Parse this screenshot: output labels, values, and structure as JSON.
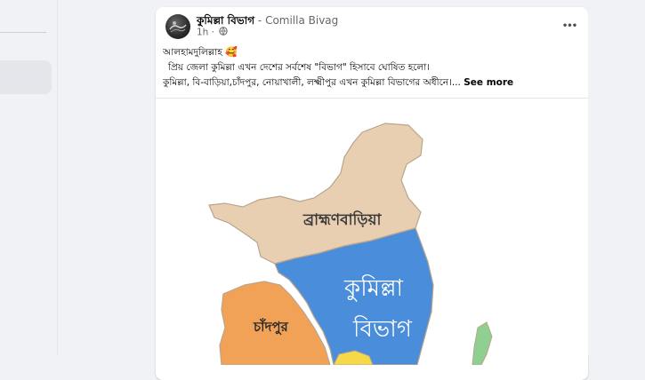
{
  "post": {
    "page_name": "কুমিল্লা বিভাগ",
    "separator": " - ",
    "page_name_en": "Comilla Bivag",
    "time": "1h",
    "meta_dot": " · ",
    "privacy_icon": "globe-icon",
    "more_icon": "more-horizontal-icon",
    "more_label": "•••",
    "text_line1": "আলহামদুলিল্লাহ",
    "emoji": "🥰",
    "text_line2": "প্রিয় জেলা কুমিল্লা এখন দেশের সর্বশেষ \"বিভাগ\" হিসাবে ঘোষিত হলো।",
    "text_line3": "কুমিল্লা, বি-বাড়িয়া,চাঁদপুর, নোয়াখালী, লক্ষ্মীপুর এখন কুমিল্লা বিভাগের অধীনে।... ",
    "see_more": "See more"
  },
  "map": {
    "labels": {
      "brahmanbaria": "ব্রাহ্মণবাড়িয়া",
      "comilla_line1": "কুমিল্লা",
      "comilla_line2": "বিভাগ",
      "chandpur": "চাঁদপুর"
    },
    "colors": {
      "brahmanbaria": "#e9cfb2",
      "comilla": "#4a8edb",
      "chandpur": "#f2a257",
      "island": "#8fcf92",
      "yellow": "#f5d94b",
      "border": "#b9a58c"
    }
  }
}
